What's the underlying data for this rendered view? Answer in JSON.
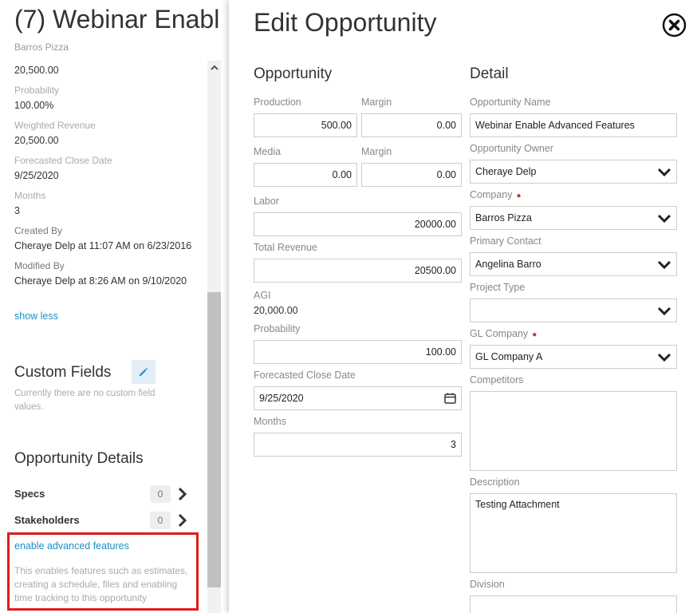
{
  "left": {
    "title": "(7) Webinar Enabl",
    "subtitle": "Barros Pizza",
    "revenue_value": "20,500.00",
    "fields": [
      {
        "label": "Probability",
        "value": "100.00%"
      },
      {
        "label": "Weighted Revenue",
        "value": "20,500.00"
      },
      {
        "label": "Forecasted Close Date",
        "value": "9/25/2020"
      },
      {
        "label": "Months",
        "value": "3"
      },
      {
        "label": "Created By",
        "value": "Cheraye Delp at 11:07 AM on 6/23/2016"
      },
      {
        "label": "Modified By",
        "value": "Cheraye Delp at 8:26 AM on 9/10/2020"
      }
    ],
    "show_less": "show less",
    "custom_fields": {
      "title": "Custom Fields",
      "note": "Currently there are no custom field values."
    },
    "opportunity_details": {
      "title": "Opportunity Details",
      "rows": [
        {
          "label": "Specs",
          "count": "0"
        },
        {
          "label": "Stakeholders",
          "count": "0"
        }
      ]
    },
    "advanced": {
      "link": "enable advanced features",
      "note": "This enables features such as estimates, creating a schedule, files and enabling time tracking to this opportunity"
    }
  },
  "modal": {
    "title": "Edit Opportunity",
    "opportunity": {
      "heading": "Opportunity",
      "production_label": "Production",
      "production_value": "500.00",
      "margin1_label": "Margin",
      "margin1_value": "0.00",
      "media_label": "Media",
      "media_value": "0.00",
      "margin2_label": "Margin",
      "margin2_value": "0.00",
      "labor_label": "Labor",
      "labor_value": "20000.00",
      "total_revenue_label": "Total Revenue",
      "total_revenue_value": "20500.00",
      "agi_label": "AGI",
      "agi_value": "20,000.00",
      "probability_label": "Probability",
      "probability_value": "100.00",
      "close_date_label": "Forecasted Close Date",
      "close_date_value": "9/25/2020",
      "months_label": "Months",
      "months_value": "3"
    },
    "detail": {
      "heading": "Detail",
      "name_label": "Opportunity Name",
      "name_value": "Webinar Enable Advanced Features",
      "owner_label": "Opportunity Owner",
      "owner_value": "Cheraye Delp",
      "company_label": "Company",
      "company_value": "Barros Pizza",
      "contact_label": "Primary Contact",
      "contact_value": "Angelina Barro",
      "project_type_label": "Project Type",
      "project_type_value": "",
      "gl_company_label": "GL Company",
      "gl_company_value": "GL Company A",
      "competitors_label": "Competitors",
      "competitors_value": "",
      "description_label": "Description",
      "description_value": "Testing Attachment",
      "division_label": "Division",
      "required_marker": "●"
    }
  },
  "colors": {
    "link": "#1b8fc2",
    "highlight_border": "#e11b1b",
    "required": "#c0392b"
  }
}
